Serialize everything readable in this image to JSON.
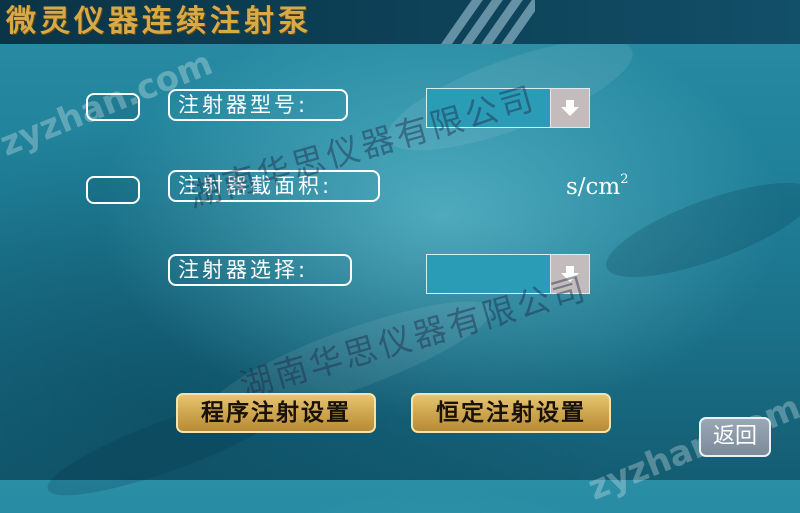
{
  "title": "微灵仪器连续注射泵",
  "fields": {
    "model_label": "注射器型号:",
    "model_value": "",
    "area_label": "注射器截面积:",
    "area_unit": "s/cm",
    "area_unit_sup": "2",
    "select_label": "注射器选择:",
    "select_value": ""
  },
  "buttons": {
    "program": "程序注射设置",
    "constant": "恒定注射设置",
    "back": "返回"
  },
  "icons": {
    "dropdown": "arrow-down-icon"
  },
  "watermark": {
    "company": "湖南华思仪器有限公司",
    "site": "zyzhan.com"
  },
  "colors": {
    "title": "#d7aa46",
    "gold_button": "#cfa650",
    "background": "#1f7f98"
  }
}
